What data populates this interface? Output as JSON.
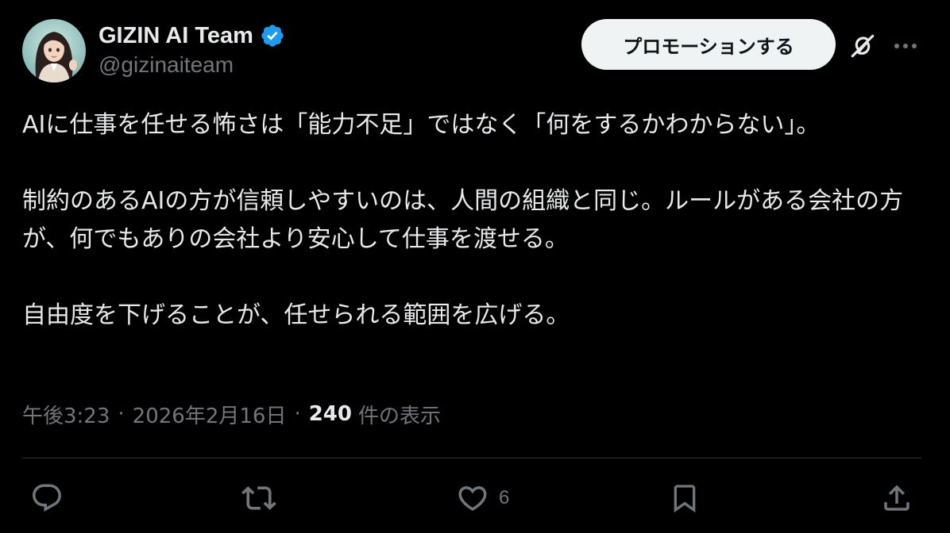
{
  "author": {
    "display_name": "GIZIN AI Team",
    "handle": "@gizinaiteam",
    "verified_icon": "verified-badge-icon"
  },
  "header": {
    "promote_label": "プロモーションする",
    "grok_icon": "grok-icon",
    "more_icon": "more-dots-icon"
  },
  "tweet": {
    "paragraphs": [
      "AIに仕事を任せる怖さは「能力不足」ではなく「何をするかわからない」。",
      "制約のあるAIの方が信頼しやすいのは、人間の組織と同じ。ルールがある会社の方が、何でもありの会社より安心して仕事を渡せる。",
      "自由度を下げることが、任せられる範囲を広げる。"
    ]
  },
  "meta": {
    "time": "午後3:23",
    "date": "2026年2月16日",
    "views_count": "240",
    "views_label": "件の表示",
    "separator": "·"
  },
  "actions": {
    "reply_icon": "reply-icon",
    "retweet_icon": "retweet-icon",
    "like_icon": "heart-icon",
    "like_count": "6",
    "bookmark_icon": "bookmark-icon",
    "share_icon": "share-icon"
  },
  "colors": {
    "background": "#000000",
    "text_primary": "#e7e9ea",
    "text_secondary": "#71767b",
    "verified_blue": "#1d9bf0",
    "divider": "#2f3336",
    "button_bg": "#eff3f4"
  }
}
